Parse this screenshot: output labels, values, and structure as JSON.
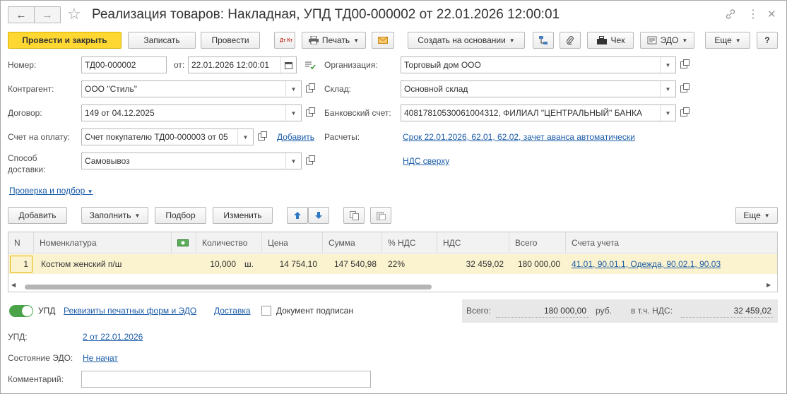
{
  "window": {
    "title": "Реализация товаров: Накладная, УПД ТД00-000002 от 22.01.2026 12:00:01",
    "nav_back": "←",
    "nav_forward": "→",
    "star": "☆",
    "link_icon": "link-icon",
    "more_icon": "⋮",
    "close_icon": "✕"
  },
  "toolbar": {
    "post_close": "Провести и закрыть",
    "save": "Записать",
    "post": "Провести",
    "dtkt": "Дт Кт",
    "print": "Печать",
    "create_based": "Создать на основании",
    "receipt": "Чек",
    "edo": "ЭДО",
    "more": "Еще",
    "help": "?"
  },
  "form": {
    "number_label": "Номер:",
    "number_value": "ТД00-000002",
    "date_label": "от:",
    "date_value": "22.01.2026 12:00:01",
    "org_label": "Организация:",
    "org_value": "Торговый дом ООО",
    "counterparty_label": "Контрагент:",
    "counterparty_value": "ООО \"Стиль\"",
    "warehouse_label": "Склад:",
    "warehouse_value": "Основной склад",
    "contract_label": "Договор:",
    "contract_value": "149 от 04.12.2025",
    "bank_label": "Банковский счет:",
    "bank_value": "40817810530061004312, ФИЛИАЛ \"ЦЕНТРАЛЬНЫЙ\" БАНКА",
    "invoice_label": "Счет на оплату:",
    "invoice_value": "Счет покупателю ТД00-000003 от 05",
    "invoice_add": "Добавить",
    "settlements_label": "Расчеты:",
    "settlements_link": "Срок 22.01.2026, 62.01, 62.02, зачет аванса автоматически",
    "delivery_label_1": "Способ",
    "delivery_label_2": "доставки:",
    "delivery_value": "Самовывоз",
    "vat_link": "НДС сверху",
    "check_link": "Проверка и подбор"
  },
  "table_toolbar": {
    "add": "Добавить",
    "fill": "Заполнить",
    "pick": "Подбор",
    "change": "Изменить",
    "more": "Еще"
  },
  "table": {
    "headers": [
      "N",
      "Номенклатура",
      "",
      "Количество",
      "Цена",
      "Сумма",
      "% НДС",
      "НДС",
      "Всего",
      "Счета учета"
    ],
    "rows": [
      {
        "n": "1",
        "item": "Костюм женский п/ш",
        "qty": "10,000",
        "unit": "ш.",
        "price": "14 754,10",
        "sum": "147 540,98",
        "vat_rate": "22%",
        "vat": "32 459,02",
        "total": "180 000,00",
        "accounts": "41.01, 90.01.1, Одежда, 90.02.1, 90.03"
      }
    ]
  },
  "footer": {
    "upd_label": "УПД",
    "print_forms_link": "Реквизиты печатных форм и ЭДО",
    "delivery_link": "Доставка",
    "signed_label": "Документ подписан",
    "total_label": "Всего:",
    "total_value": "180 000,00",
    "currency": "руб.",
    "vat_incl_label": "в т.ч. НДС:",
    "vat_incl_value": "32 459,02",
    "upd2_label": "УПД:",
    "upd2_link": "2 от 22.01.2026",
    "edo_state_label": "Состояние ЭДО:",
    "edo_state_link": "Не начат",
    "comment_label": "Комментарий:",
    "comment_value": ""
  },
  "colors": {
    "primary_button": "#ffd732",
    "link": "#1a5ba8",
    "selected_row": "#fbf3d0",
    "toggle_on": "#4aa349"
  }
}
